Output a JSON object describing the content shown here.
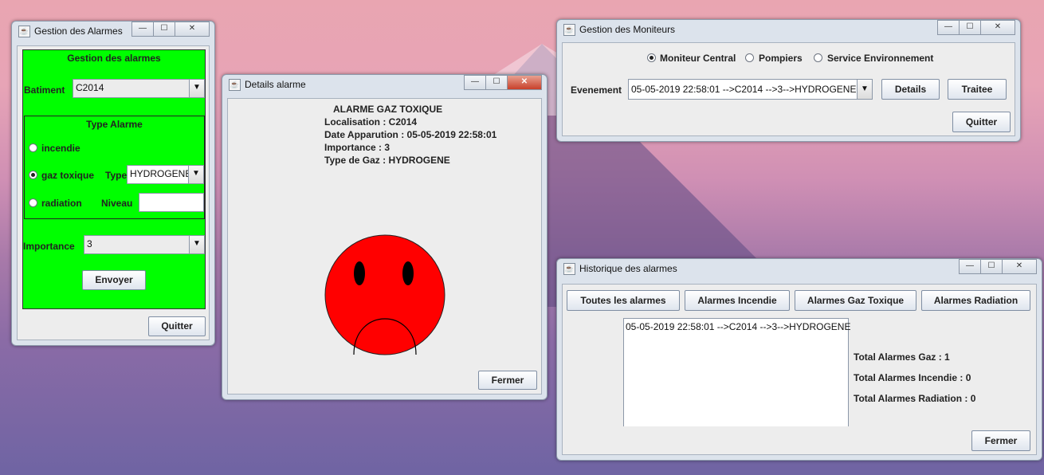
{
  "win_gestion": {
    "title": "Gestion des Alarmes",
    "header": "Gestion des alarmes",
    "batiment_label": "Batiment",
    "batiment_value": "C2014",
    "type_header": "Type Alarme",
    "radio_incendie": "incendie",
    "radio_gaz": "gaz toxique",
    "type_label": "Type",
    "type_value": "HYDROGENE",
    "radio_radiation": "radiation",
    "niveau_label": "Niveau",
    "niveau_value": "",
    "importance_label": "Importance",
    "importance_value": "3",
    "envoyer": "Envoyer",
    "quitter": "Quitter"
  },
  "win_details": {
    "title": "Details alarme",
    "heading": "ALARME GAZ TOXIQUE",
    "localisation": "Localisation : C2014",
    "date": "Date Apparution : 05-05-2019 22:58:01",
    "importance": "Importance : 3",
    "type_gaz": "Type de Gaz : HYDROGENE",
    "fermer": "Fermer"
  },
  "win_moniteurs": {
    "title": "Gestion des Moniteurs",
    "radio_central": "Moniteur Central",
    "radio_pompiers": "Pompiers",
    "radio_env": "Service Environnement",
    "evenement_label": "Evenement",
    "evenement_value": "05-05-2019 22:58:01 -->C2014 -->3-->HYDROGENE",
    "details": "Details",
    "traitee": "Traitee",
    "quitter": "Quitter"
  },
  "win_historique": {
    "title": "Historique des alarmes",
    "btn_toutes": "Toutes les alarmes",
    "btn_incendie": "Alarmes Incendie",
    "btn_gaz": "Alarmes Gaz Toxique",
    "btn_radiation": "Alarmes Radiation",
    "list_items": [
      "05-05-2019 22:58:01 -->C2014 -->3-->HYDROGENE"
    ],
    "total_gaz": "Total Alarmes Gaz : 1",
    "total_incendie": "Total Alarmes Incendie : 0",
    "total_radiation": "Total Alarmes Radiation : 0",
    "fermer": "Fermer"
  },
  "window_buttons": {
    "minimize": "—",
    "maximize": "☐",
    "close": "✕"
  },
  "colors": {
    "green_panel": "#00ff00",
    "smiley": "#ff0000"
  }
}
